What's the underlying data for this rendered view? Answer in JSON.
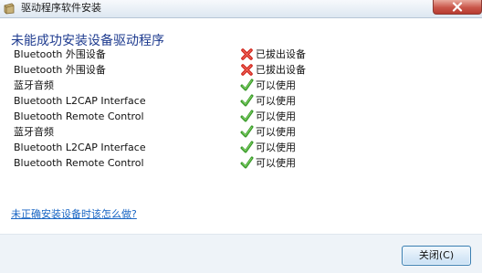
{
  "window": {
    "title": "驱动程序软件安装"
  },
  "dialog": {
    "heading": "未能成功安装设备驱动程序",
    "devices": [
      {
        "name": "Bluetooth 外围设备",
        "status": "已拔出设备",
        "icon": "error-x-icon"
      },
      {
        "name": "Bluetooth 外围设备",
        "status": "已拔出设备",
        "icon": "error-x-icon"
      },
      {
        "name": "蓝牙音频",
        "status": "可以使用",
        "icon": "check-icon"
      },
      {
        "name": "Bluetooth L2CAP Interface",
        "status": "可以使用",
        "icon": "check-icon"
      },
      {
        "name": "Bluetooth Remote Control",
        "status": "可以使用",
        "icon": "check-icon"
      },
      {
        "name": "蓝牙音频",
        "status": "可以使用",
        "icon": "check-icon"
      },
      {
        "name": "Bluetooth L2CAP Interface",
        "status": "可以使用",
        "icon": "check-icon"
      },
      {
        "name": "Bluetooth Remote Control",
        "status": "可以使用",
        "icon": "check-icon"
      }
    ],
    "help_link": "未正确安装设备时该怎么做?",
    "close_button": "关闭(C)"
  },
  "colors": {
    "heading": "#1e3b8f",
    "link": "#1a66c4",
    "error": "#d0251c",
    "success": "#3a9a2a"
  }
}
